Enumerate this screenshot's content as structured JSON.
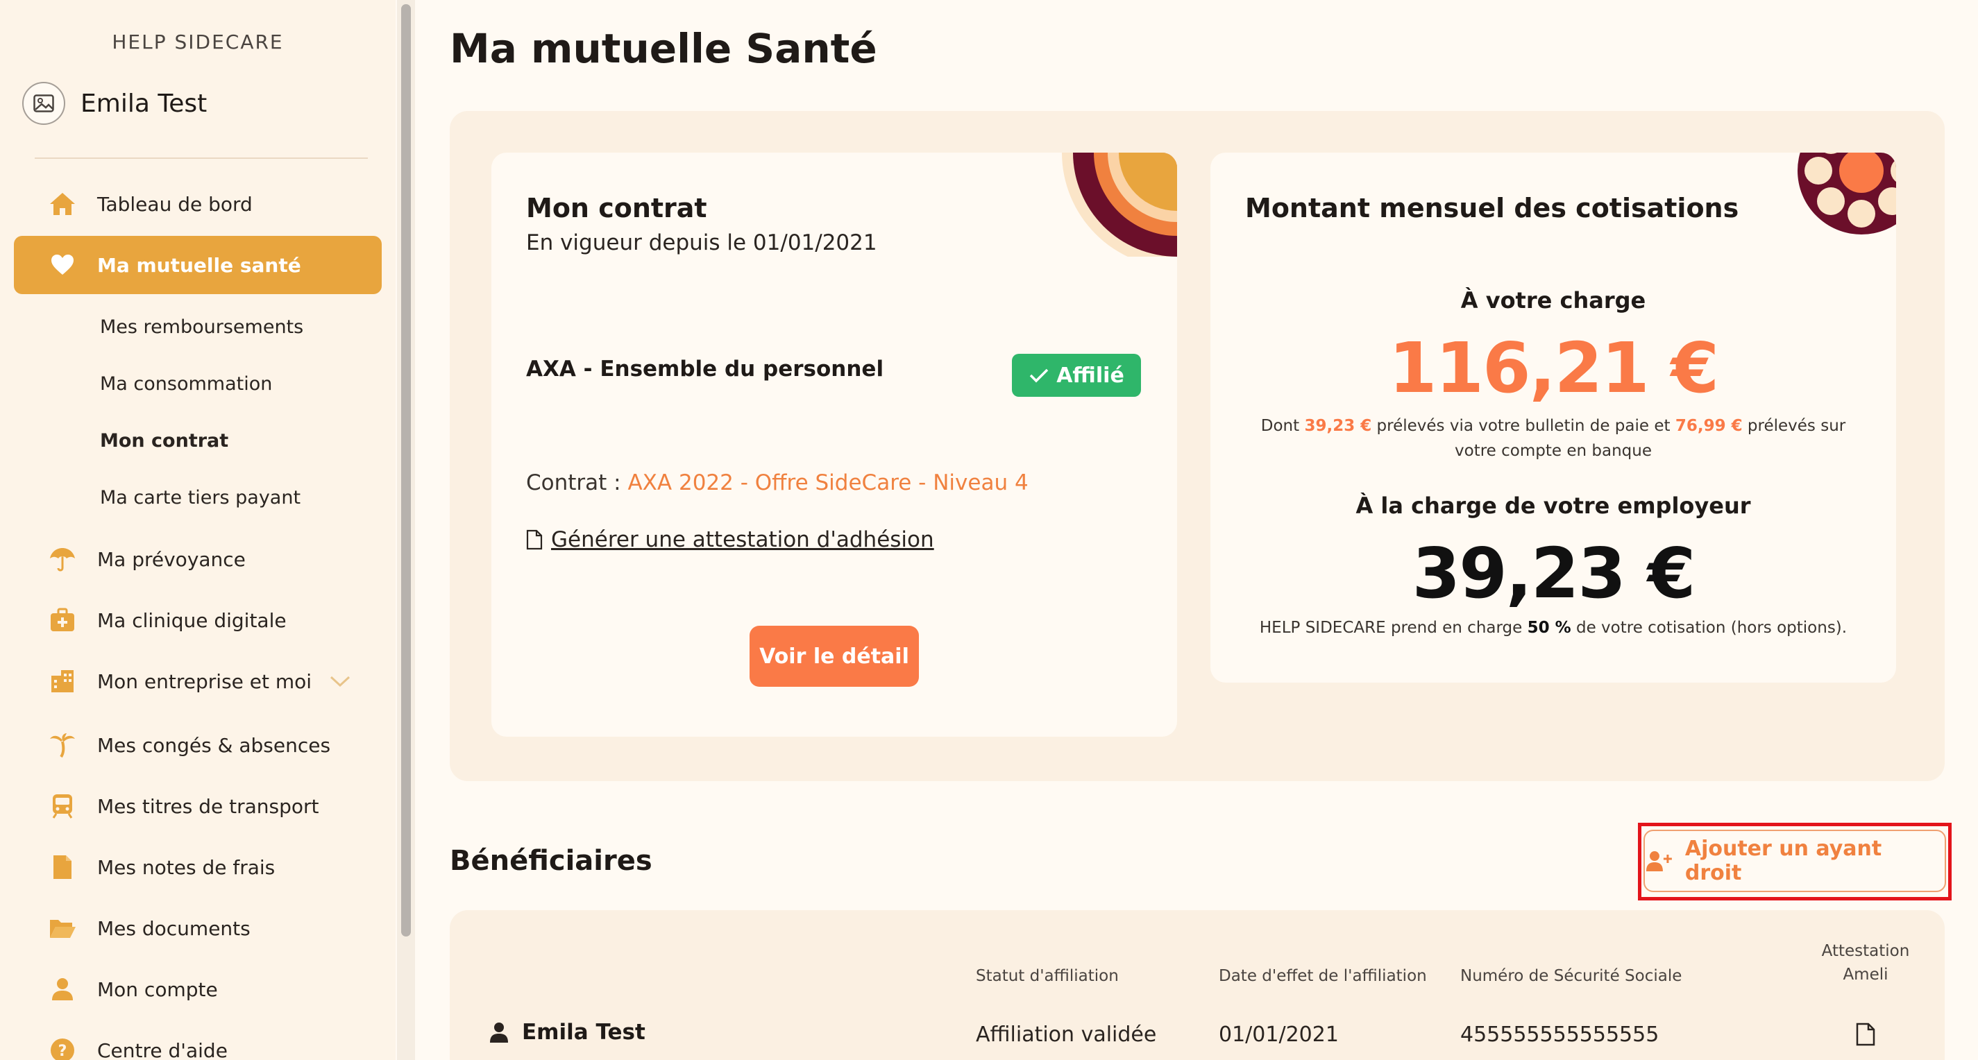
{
  "sidebar": {
    "company": "HELP SIDECARE",
    "user_name": "Emila Test",
    "nav": [
      {
        "label": "Tableau de bord",
        "icon": "home-icon"
      },
      {
        "label": "Ma mutuelle santé",
        "icon": "heart-icon",
        "active": true
      },
      {
        "label": "Ma prévoyance",
        "icon": "umbrella-icon"
      },
      {
        "label": "Ma clinique digitale",
        "icon": "medical-kit-icon"
      },
      {
        "label": "Mon entreprise et moi",
        "icon": "building-icon"
      },
      {
        "label": "Mes congés & absences",
        "icon": "palm-tree-icon"
      },
      {
        "label": "Mes titres de transport",
        "icon": "train-icon"
      },
      {
        "label": "Mes notes de frais",
        "icon": "document-icon"
      },
      {
        "label": "Mes documents",
        "icon": "folder-icon"
      },
      {
        "label": "Mon compte",
        "icon": "user-icon"
      },
      {
        "label": "Centre d'aide",
        "icon": "help-icon"
      }
    ],
    "subnav": [
      {
        "label": "Mes remboursements"
      },
      {
        "label": "Ma consommation"
      },
      {
        "label": "Mon contrat",
        "bold": true
      },
      {
        "label": "Ma carte tiers payant"
      }
    ]
  },
  "page": {
    "title": "Ma mutuelle Santé"
  },
  "contract": {
    "title": "Mon contrat",
    "since": "En vigueur depuis le 01/01/2021",
    "insurer": "AXA - Ensemble du personnel",
    "status": "Affilié",
    "contract_label": "Contrat : ",
    "contract_name": "AXA 2022 - Offre SideCare - Niveau 4",
    "attestation_link": "Générer une attestation d'adhésion",
    "detail_button": "Voir le détail"
  },
  "cotisations": {
    "title": "Montant mensuel des cotisations",
    "your_charge_label": "À votre charge",
    "your_charge_amount": "116,21 €",
    "detail_prefix": "Dont ",
    "detail_payroll": "39,23 €",
    "detail_middle": " prélevés via votre bulletin de paie et ",
    "detail_bank": "76,99 €",
    "detail_suffix": " prélevés sur votre compte en banque",
    "employer_label": "À la charge de votre employeur",
    "employer_amount": "39,23 €",
    "employer_note_prefix": "HELP SIDECARE prend en charge ",
    "employer_note_pct": "50 %",
    "employer_note_suffix": " de votre cotisation (hors options)."
  },
  "beneficiaries": {
    "title": "Bénéficiaires",
    "add_button": "Ajouter un ayant droit",
    "columns": {
      "status": "Statut d'affiliation",
      "date": "Date d'effet de l'affiliation",
      "ssn": "Numéro de Sécurité Sociale",
      "ameli_line1": "Attestation",
      "ameli_line2": "Ameli"
    },
    "rows": [
      {
        "name": "Emila Test",
        "status": "Affiliation validée",
        "date": "01/01/2021",
        "ssn": "455555555555555"
      }
    ]
  },
  "colors": {
    "accent": "#e8a53e",
    "orange": "#fa7a47",
    "success": "#2fb66a",
    "highlight": "#e3141b",
    "burgundy": "#6b0f2a"
  }
}
